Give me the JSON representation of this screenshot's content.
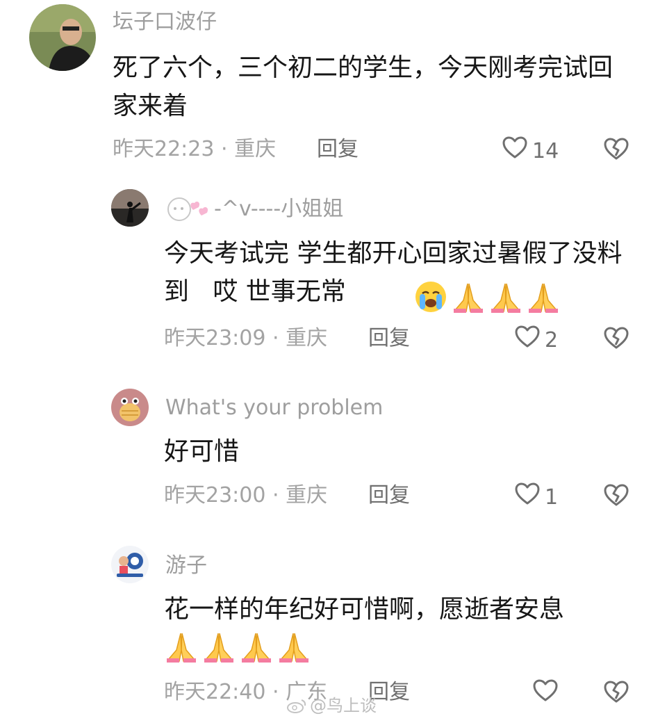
{
  "comments": [
    {
      "username": "坛子口波仔",
      "text": "死了六个，三个初二的学生，今天刚考完试回家来着",
      "time_location": "昨天22:23 · 重庆",
      "reply_label": "回复",
      "likes": "14"
    },
    {
      "username": "-^v----小姐姐",
      "text": "今天考试完 学生都开心回家过暑假了没料到   哎 世事无常",
      "time_location": "昨天23:09 · 重庆",
      "reply_label": "回复",
      "likes": "2",
      "emojis": [
        "crying-face-icon",
        "folded-hands-icon",
        "folded-hands-icon",
        "folded-hands-icon"
      ]
    },
    {
      "username": "What's your problem",
      "text": "好可惜",
      "time_location": "昨天23:00 · 重庆",
      "reply_label": "回复",
      "likes": "1"
    },
    {
      "username": "游子",
      "text": "花一样的年纪好可惜啊，愿逝者安息",
      "time_location": "昨天22:40 · 广东",
      "reply_label": "回复",
      "likes": "",
      "emojis": [
        "folded-hands-icon",
        "folded-hands-icon",
        "folded-hands-icon",
        "folded-hands-icon"
      ]
    }
  ],
  "watermark": "@鸟上谈",
  "colors": {
    "username": "#9e9e9e",
    "text": "#161616",
    "meta": "#a3a3a3",
    "icon": "#6f6f6f"
  }
}
